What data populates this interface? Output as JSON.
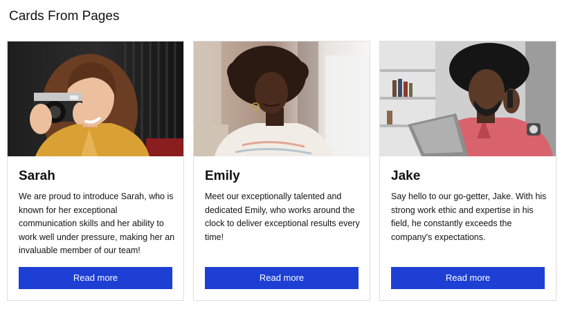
{
  "page": {
    "title": "Cards From Pages"
  },
  "cards": [
    {
      "name": "Sarah",
      "description": "We are proud to introduce Sarah, who is known for her exceptional communication skills and her ability to work well under pressure, making her an invaluable member of our team!",
      "button_label": "Read more"
    },
    {
      "name": "Emily",
      "description": "Meet our exceptionally talented and dedicated Emily, who works around the clock to deliver exceptional results every time!",
      "button_label": "Read more"
    },
    {
      "name": "Jake",
      "description": "Say hello to our go-getter, Jake. With his strong work ethic and expertise in his field, he constantly exceeds the company's expectations.",
      "button_label": "Read more"
    }
  ],
  "colors": {
    "button_background": "#1d3fd4",
    "button_text": "#ffffff",
    "card_border": "#dedede"
  }
}
